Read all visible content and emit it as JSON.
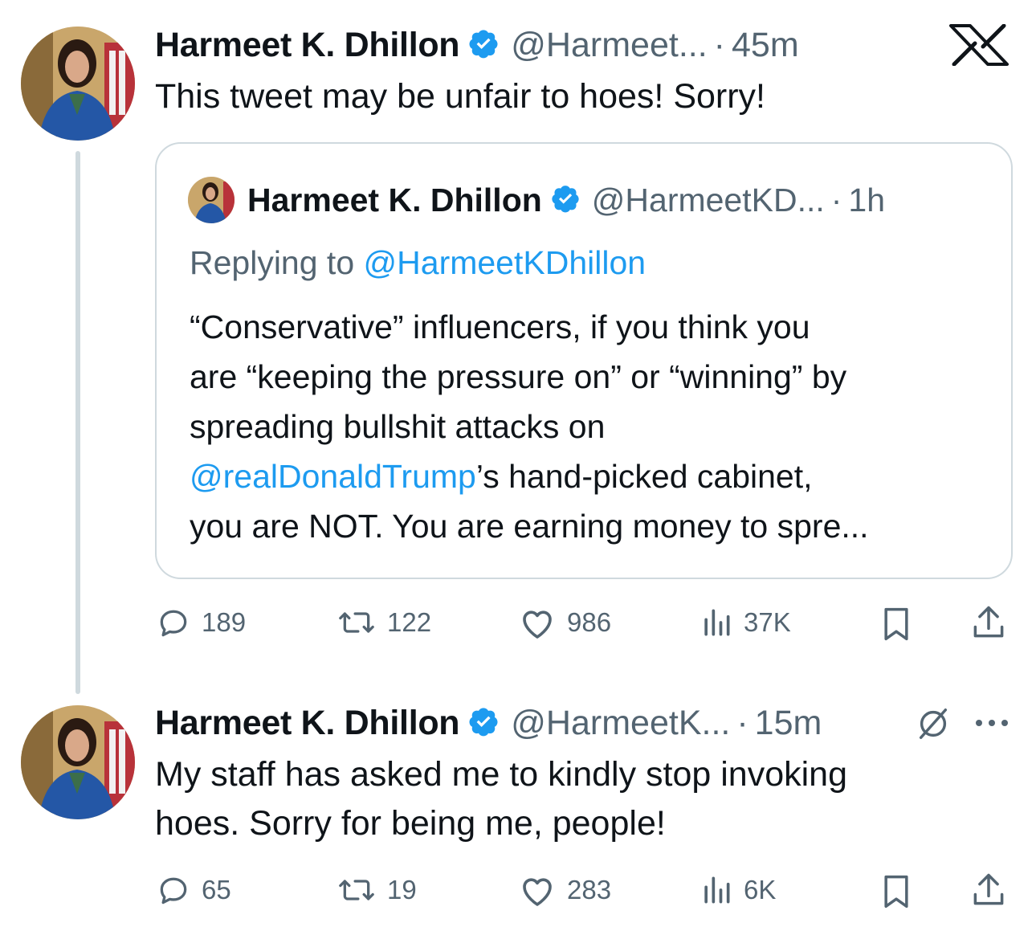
{
  "colors": {
    "text": "#0f1419",
    "secondary": "#536471",
    "link": "#1d9bf0",
    "verified": "#1d9bf0",
    "border": "#cfd9de"
  },
  "platform_icon": "x-logo-icon",
  "tweet1": {
    "name": "Harmeet K. Dhillon",
    "handle": "@Harmeet...",
    "separator": "·",
    "time": "45m",
    "text": "This tweet may be unfair to hoes! Sorry!",
    "quote": {
      "name": "Harmeet K. Dhillon",
      "handle": "@HarmeetKD...",
      "separator": "·",
      "time": "1h",
      "replying_label": "Replying to",
      "replying_handle": "@HarmeetKDhillon",
      "text_line1": "“Conservative” influencers, if you think you",
      "text_line2": "are “keeping the pressure on” or “winning” by",
      "text_line3": "spreading bullshit attacks on",
      "text_mention": "@realDonaldTrump",
      "text_line4_rest": "’s hand-picked cabinet,",
      "text_line5": "you are NOT. You are earning money to spre..."
    },
    "actions": {
      "replies": "189",
      "reposts": "122",
      "likes": "986",
      "views": "37K"
    }
  },
  "tweet2": {
    "name": "Harmeet K. Dhillon",
    "handle": "@HarmeetK...",
    "separator": "·",
    "time": "15m",
    "text_line1": "My staff has asked me to kindly stop invoking",
    "text_line2": "hoes. Sorry for being me, people!",
    "actions": {
      "replies": "65",
      "reposts": "19",
      "likes": "283",
      "views": "6K"
    }
  }
}
